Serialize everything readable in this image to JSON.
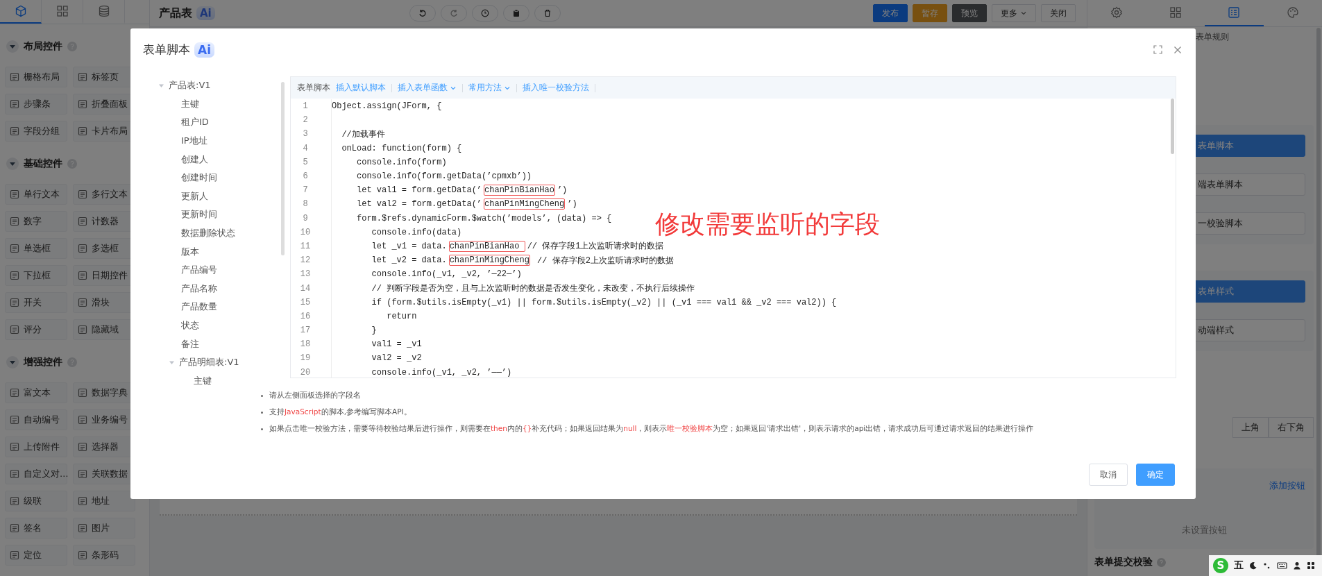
{
  "sidebar": {
    "tabs": [
      {
        "kind": "widget",
        "selected": true
      },
      {
        "kind": "grid",
        "selected": false
      },
      {
        "kind": "database",
        "selected": false
      }
    ],
    "groups": [
      {
        "title": "布局控件",
        "expanded": true,
        "items": [
          "栅格布局",
          "标签页",
          "步骤条",
          "折叠面板",
          "字段分组",
          "卡片布局"
        ]
      },
      {
        "title": "基础控件",
        "expanded": true,
        "items": [
          "单行文本",
          "多行文本",
          "数字",
          "计数器",
          "单选框",
          "多选框",
          "下拉框",
          "日期控件",
          "开关",
          "滑块",
          "评分",
          "隐藏域"
        ]
      },
      {
        "title": "增强控件",
        "expanded": true,
        "items": [
          "富文本",
          "数据字典",
          "自动编号",
          "业务编号",
          "上传附件",
          "选择器",
          "自定义对…",
          "关联数据",
          "级联",
          "地址",
          "签名",
          "图片",
          "定位",
          "条形码"
        ]
      }
    ]
  },
  "top_bar": {
    "title": "产品表",
    "badge": "Ai",
    "tools": [
      {
        "kind": "undo"
      },
      {
        "kind": "redo"
      },
      {
        "kind": "circle"
      },
      {
        "kind": "clipboard"
      },
      {
        "kind": "trash"
      }
    ],
    "buttons": [
      {
        "label": "发布",
        "kind": "primary"
      },
      {
        "label": "暂存",
        "kind": "warning"
      },
      {
        "label": "预览",
        "kind": "info"
      },
      {
        "label": "更多",
        "kind": "dropdown"
      },
      {
        "label": "关闭",
        "kind": "plain"
      }
    ]
  },
  "right_panel": {
    "tabs": [
      {
        "kind": "settings",
        "selected": false
      },
      {
        "kind": "grid",
        "selected": false
      },
      {
        "kind": "form",
        "selected": true
      },
      {
        "kind": "palette",
        "selected": false
      }
    ],
    "rules_text": "表单规则",
    "script_buttons": [
      {
        "label": "表单脚本",
        "primary": true
      },
      {
        "label": "端表单脚本",
        "primary": false
      },
      {
        "label": "一校验脚本",
        "primary": false
      }
    ],
    "style_buttons": [
      {
        "label": "表单样式",
        "primary": true
      },
      {
        "label": "动端样式",
        "primary": false
      }
    ],
    "position_options": [
      {
        "label": "上角",
        "selected": false
      },
      {
        "label": "右下角",
        "selected": false
      }
    ],
    "add_button_link": "添加按钮",
    "empty_text": "未设置按钮",
    "submit_validation_title": "表单提交校验"
  },
  "modal": {
    "title": "表单脚本",
    "badge": "Ai",
    "tree": [
      {
        "label": "产品表:V1",
        "expanded": true,
        "children": [
          {
            "label": "主键"
          },
          {
            "label": "租户ID"
          },
          {
            "label": "IP地址"
          },
          {
            "label": "创建人"
          },
          {
            "label": "创建时间"
          },
          {
            "label": "更新人"
          },
          {
            "label": "更新时间"
          },
          {
            "label": "数据删除状态"
          },
          {
            "label": "版本"
          },
          {
            "label": "产品编号"
          },
          {
            "label": "产品名称"
          },
          {
            "label": "产品数量"
          },
          {
            "label": "状态"
          },
          {
            "label": "备注"
          },
          {
            "label": "产品明细表:V1",
            "expanded": true,
            "children": [
              {
                "label": "主键"
              }
            ]
          }
        ]
      }
    ],
    "editor": {
      "label": "表单脚本",
      "actions": [
        {
          "label": "插入默认脚本",
          "dropdown": false
        },
        {
          "label": "插入表单函数",
          "dropdown": true
        },
        {
          "label": "常用方法",
          "dropdown": true
        },
        {
          "label": "插入唯一校验方法",
          "dropdown": false
        }
      ],
      "lines": [
        {
          "number": "1",
          "parts": [
            {
              "text": "Object.assign(JForm, {",
              "boxed": false
            }
          ]
        },
        {
          "number": "2"
        },
        {
          "number": "3",
          "parts": [
            {
              "text": "  //加载事件",
              "boxed": false
            }
          ]
        },
        {
          "number": "4",
          "parts": [
            {
              "text": "  onLoad: function(form) {",
              "boxed": false
            }
          ]
        },
        {
          "number": "5",
          "parts": [
            {
              "text": "     console.info(form)",
              "boxed": false
            }
          ]
        },
        {
          "number": "6",
          "parts": [
            {
              "text": "     console.info(form.getData(’cpmxb’))",
              "boxed": false
            }
          ]
        },
        {
          "number": "7",
          "parts": [
            {
              "text": "     let val1 = form.getData(’",
              "boxed": false
            },
            {
              "text": "chanPinBianHao",
              "boxed": true
            },
            {
              "text": "’)",
              "boxed": false
            }
          ]
        },
        {
          "number": "8",
          "parts": [
            {
              "text": "     let val2 = form.getData(’",
              "boxed": false
            },
            {
              "text": "chanPinMingCheng",
              "boxed": true
            },
            {
              "text": "’)",
              "boxed": false
            }
          ]
        },
        {
          "number": "9",
          "parts": [
            {
              "text": "     form.$refs.dynamicForm.$watch(’models’, (data) => {",
              "boxed": false
            }
          ]
        },
        {
          "number": "10",
          "parts": [
            {
              "text": "        console.info(data)",
              "boxed": false
            }
          ]
        },
        {
          "number": "11",
          "parts": [
            {
              "text": "        let _v1 = data.",
              "boxed": false
            },
            {
              "text": "chanPinBianHao ",
              "boxed": true
            },
            {
              "text": "// 保存字段1上次监听请求时的数据",
              "boxed": false
            }
          ]
        },
        {
          "number": "12",
          "parts": [
            {
              "text": "        let _v2 = data.",
              "boxed": false
            },
            {
              "text": "chanPinMingCheng",
              "boxed": true
            },
            {
              "text": " // 保存字段2上次监听请求时的数据",
              "boxed": false
            }
          ]
        },
        {
          "number": "13",
          "parts": [
            {
              "text": "        console.info(_v1, _v2, ’—22—’)",
              "boxed": false
            }
          ]
        },
        {
          "number": "14",
          "parts": [
            {
              "text": "        // 判断字段是否为空，且与上次监听时的数据是否发生变化，未改变，不执行后续操作",
              "boxed": false
            }
          ]
        },
        {
          "number": "15",
          "parts": [
            {
              "text": "        if (form.$utils.isEmpty(_v1) || form.$utils.isEmpty(_v2) || (_v1 === val1 && _v2 === val2)) {",
              "boxed": false
            }
          ]
        },
        {
          "number": "16",
          "parts": [
            {
              "text": "           return",
              "boxed": false
            }
          ]
        },
        {
          "number": "17",
          "parts": [
            {
              "text": "        }",
              "boxed": false
            }
          ]
        },
        {
          "number": "18",
          "parts": [
            {
              "text": "        val1 = _v1",
              "boxed": false
            }
          ]
        },
        {
          "number": "19",
          "parts": [
            {
              "text": "        val2 = _v2",
              "boxed": false
            }
          ]
        },
        {
          "number": "20",
          "parts": [
            {
              "text": "        console.info(_v1, _v2, ’——’)",
              "boxed": false
            }
          ]
        }
      ]
    },
    "annotation": "修改需要监听的字段",
    "notes": [
      [
        {
          "text": "请从左侧面板选择的字段名",
          "highlight": false
        }
      ],
      [
        {
          "text": "支持",
          "highlight": false
        },
        {
          "text": "JavaScript",
          "highlight": true
        },
        {
          "text": "的脚本,参考编写脚本API。",
          "highlight": false
        }
      ],
      [
        {
          "text": "如果点击唯一校验方法，需要等待校验结果后进行操作，则需要在",
          "highlight": false
        },
        {
          "text": "then",
          "highlight": true
        },
        {
          "text": "内的",
          "highlight": false
        },
        {
          "text": "{}",
          "highlight": true
        },
        {
          "text": "补充代码；如果返回结果为",
          "highlight": false
        },
        {
          "text": "null",
          "highlight": true
        },
        {
          "text": "，则表示",
          "highlight": false
        },
        {
          "text": "唯一校验脚本",
          "highlight": true
        },
        {
          "text": "为空；如果返回'请求出错'，则表示请求的api出错，请求成功后可通过请求返回的结果进行操作",
          "highlight": false
        }
      ]
    ],
    "buttons": [
      {
        "label": "取消",
        "primary": false
      },
      {
        "label": "确定",
        "primary": true
      }
    ]
  },
  "ime_bar": {
    "logo": "S",
    "mode": "五"
  }
}
